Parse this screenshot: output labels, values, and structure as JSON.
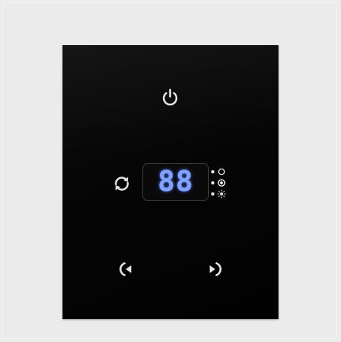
{
  "device": {
    "display": {
      "value": "88",
      "color": "#7fa4ff"
    },
    "buttons": {
      "power": {
        "icon": "power-icon"
      },
      "cycle": {
        "icon": "refresh-icon"
      },
      "previous": {
        "icon": "arrow-left-icon"
      },
      "next": {
        "icon": "arrow-right-icon"
      }
    },
    "mode_indicators": [
      {
        "icon": "circle-outline-icon"
      },
      {
        "icon": "target-icon",
        "active": true
      },
      {
        "icon": "sun-icon"
      }
    ],
    "colors": {
      "background": "#ebebeb",
      "panel": "#050505",
      "icon": "#e6e6e6"
    }
  }
}
